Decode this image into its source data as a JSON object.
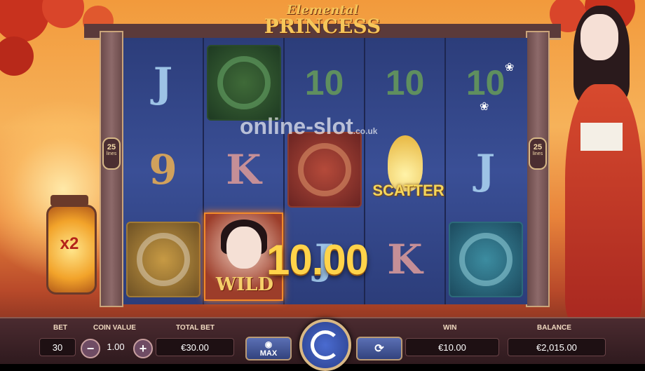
{
  "game": {
    "logo_line1": "Elemental",
    "logo_line2": "PRINCESS",
    "lines_count": "25",
    "lines_label": "lines",
    "multiplier": "x2",
    "win_popup": "10.00",
    "watermark": "online-slot",
    "watermark_suffix": ".co.uk"
  },
  "reels": [
    [
      "J",
      "9",
      "ring-gold"
    ],
    [
      "jade-green",
      "K",
      "WILD"
    ],
    [
      "10",
      "ring-red",
      "J"
    ],
    [
      "10",
      "SCATTER",
      "K"
    ],
    [
      "10",
      "J",
      "jade-blue"
    ]
  ],
  "symbols": {
    "wild_label": "WILD",
    "scatter_label": "SCATTER"
  },
  "panel": {
    "bet_label": "BET",
    "bet_value": "30",
    "coin_value_label": "COIN VALUE",
    "coin_value": "1.00",
    "minus_label": "−",
    "plus_label": "+",
    "total_bet_label": "TOTAL BET",
    "total_bet_value": "€30.00",
    "max_label": "MAX",
    "win_label": "WIN",
    "win_value": "€10.00",
    "balance_label": "BALANCE",
    "balance_value": "€2,015.00"
  },
  "colors": {
    "reel_bg": "#3a4f96",
    "gold_text": "#ffd34a",
    "panel_bg": "#2f1a1e"
  }
}
